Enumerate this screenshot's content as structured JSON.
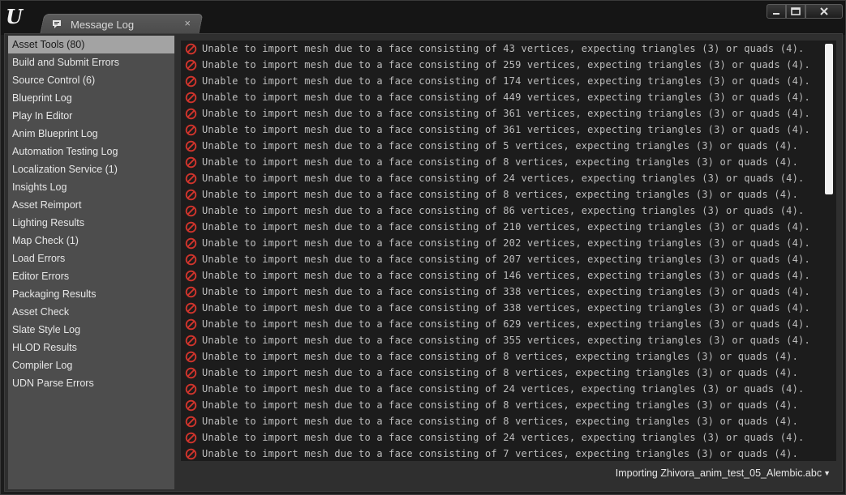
{
  "window": {
    "tab_title": "Message Log",
    "tab_close_glyph": "×",
    "controls": [
      "minimize-icon",
      "maximize-icon",
      "close-icon"
    ]
  },
  "sidebar": {
    "items": [
      {
        "label": "Asset Tools (80)",
        "selected": true
      },
      {
        "label": "Build and Submit Errors"
      },
      {
        "label": "Source Control (6)"
      },
      {
        "label": "Blueprint Log"
      },
      {
        "label": "Play In Editor"
      },
      {
        "label": "Anim Blueprint Log"
      },
      {
        "label": "Automation Testing Log"
      },
      {
        "label": "Localization Service (1)"
      },
      {
        "label": "Insights Log"
      },
      {
        "label": "Asset Reimport"
      },
      {
        "label": "Lighting Results"
      },
      {
        "label": "Map Check (1)"
      },
      {
        "label": "Load Errors"
      },
      {
        "label": "Editor Errors"
      },
      {
        "label": "Packaging Results"
      },
      {
        "label": "Asset Check"
      },
      {
        "label": "Slate Style Log"
      },
      {
        "label": "HLOD Results"
      },
      {
        "label": "Compiler Log"
      },
      {
        "label": "UDN Parse Errors"
      }
    ]
  },
  "log": {
    "icon": "error-icon",
    "error_color": "#d0342c",
    "messages": [
      "Unable to import mesh due to a face consisting of 43 vertices, expecting triangles (3) or quads (4).",
      "Unable to import mesh due to a face consisting of 259 vertices, expecting triangles (3) or quads (4).",
      "Unable to import mesh due to a face consisting of 174 vertices, expecting triangles (3) or quads (4).",
      "Unable to import mesh due to a face consisting of 449 vertices, expecting triangles (3) or quads (4).",
      "Unable to import mesh due to a face consisting of 361 vertices, expecting triangles (3) or quads (4).",
      "Unable to import mesh due to a face consisting of 361 vertices, expecting triangles (3) or quads (4).",
      "Unable to import mesh due to a face consisting of 5 vertices, expecting triangles (3) or quads (4).",
      "Unable to import mesh due to a face consisting of 8 vertices, expecting triangles (3) or quads (4).",
      "Unable to import mesh due to a face consisting of 24 vertices, expecting triangles (3) or quads (4).",
      "Unable to import mesh due to a face consisting of 8 vertices, expecting triangles (3) or quads (4).",
      "Unable to import mesh due to a face consisting of 86 vertices, expecting triangles (3) or quads (4).",
      "Unable to import mesh due to a face consisting of 210 vertices, expecting triangles (3) or quads (4).",
      "Unable to import mesh due to a face consisting of 202 vertices, expecting triangles (3) or quads (4).",
      "Unable to import mesh due to a face consisting of 207 vertices, expecting triangles (3) or quads (4).",
      "Unable to import mesh due to a face consisting of 146 vertices, expecting triangles (3) or quads (4).",
      "Unable to import mesh due to a face consisting of 338 vertices, expecting triangles (3) or quads (4).",
      "Unable to import mesh due to a face consisting of 338 vertices, expecting triangles (3) or quads (4).",
      "Unable to import mesh due to a face consisting of 629 vertices, expecting triangles (3) or quads (4).",
      "Unable to import mesh due to a face consisting of 355 vertices, expecting triangles (3) or quads (4).",
      "Unable to import mesh due to a face consisting of 8 vertices, expecting triangles (3) or quads (4).",
      "Unable to import mesh due to a face consisting of 8 vertices, expecting triangles (3) or quads (4).",
      "Unable to import mesh due to a face consisting of 24 vertices, expecting triangles (3) or quads (4).",
      "Unable to import mesh due to a face consisting of 8 vertices, expecting triangles (3) or quads (4).",
      "Unable to import mesh due to a face consisting of 8 vertices, expecting triangles (3) or quads (4).",
      "Unable to import mesh due to a face consisting of 24 vertices, expecting triangles (3) or quads (4).",
      "Unable to import mesh due to a face consisting of 7 vertices, expecting triangles (3) or quads (4)."
    ]
  },
  "footer": {
    "page_selector": "Importing Zhivora_anim_test_05_Alembic.abc"
  }
}
